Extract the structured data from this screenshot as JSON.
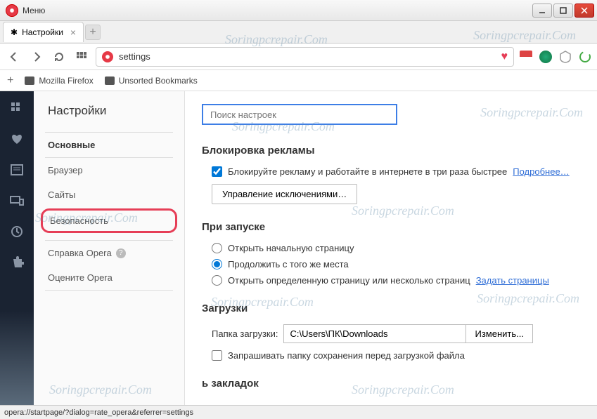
{
  "titlebar": {
    "menu": "Меню"
  },
  "tab": {
    "title": "Настройки",
    "gear_icon": "gear"
  },
  "address": {
    "url": "settings"
  },
  "bookmarks_bar": {
    "items": [
      {
        "label": "Mozilla Firefox"
      },
      {
        "label": "Unsorted Bookmarks"
      }
    ]
  },
  "settings_nav": {
    "title": "Настройки",
    "items": [
      {
        "label": "Основные",
        "kind": "bold"
      },
      {
        "label": "Браузер",
        "kind": "normal"
      },
      {
        "label": "Сайты",
        "kind": "normal"
      },
      {
        "label": "Безопасность",
        "kind": "highlighted"
      }
    ],
    "help": {
      "label": "Справка Opera"
    },
    "rate": {
      "label": "Оцените Opera"
    }
  },
  "settings_main": {
    "search_placeholder": "Поиск настроек",
    "adblock": {
      "title": "Блокировка рекламы",
      "checkbox_label": "Блокируйте рекламу и работайте в интернете в три раза быстрее",
      "learn_more": "Подробнее…",
      "manage_btn": "Управление исключениями…"
    },
    "startup": {
      "title": "При запуске",
      "options": [
        {
          "label": "Открыть начальную страницу",
          "checked": false
        },
        {
          "label": "Продолжить с того же места",
          "checked": true
        },
        {
          "label": "Открыть определенную страницу или несколько страниц",
          "checked": false
        }
      ],
      "set_pages": "Задать страницы"
    },
    "downloads": {
      "title": "Загрузки",
      "path_label": "Папка загрузки:",
      "path_value": "C:\\Users\\ПК\\Downloads",
      "change_btn": "Изменить...",
      "ask_checkbox": "Запрашивать папку сохранения перед загрузкой файла"
    },
    "bookmarks_panel": {
      "title_fragment": "ь закладок"
    }
  },
  "statusbar": {
    "text": "opera://startpage/?dialog=rate_opera&referrer=settings"
  },
  "watermark_text": "Soringpcrepair.Com"
}
